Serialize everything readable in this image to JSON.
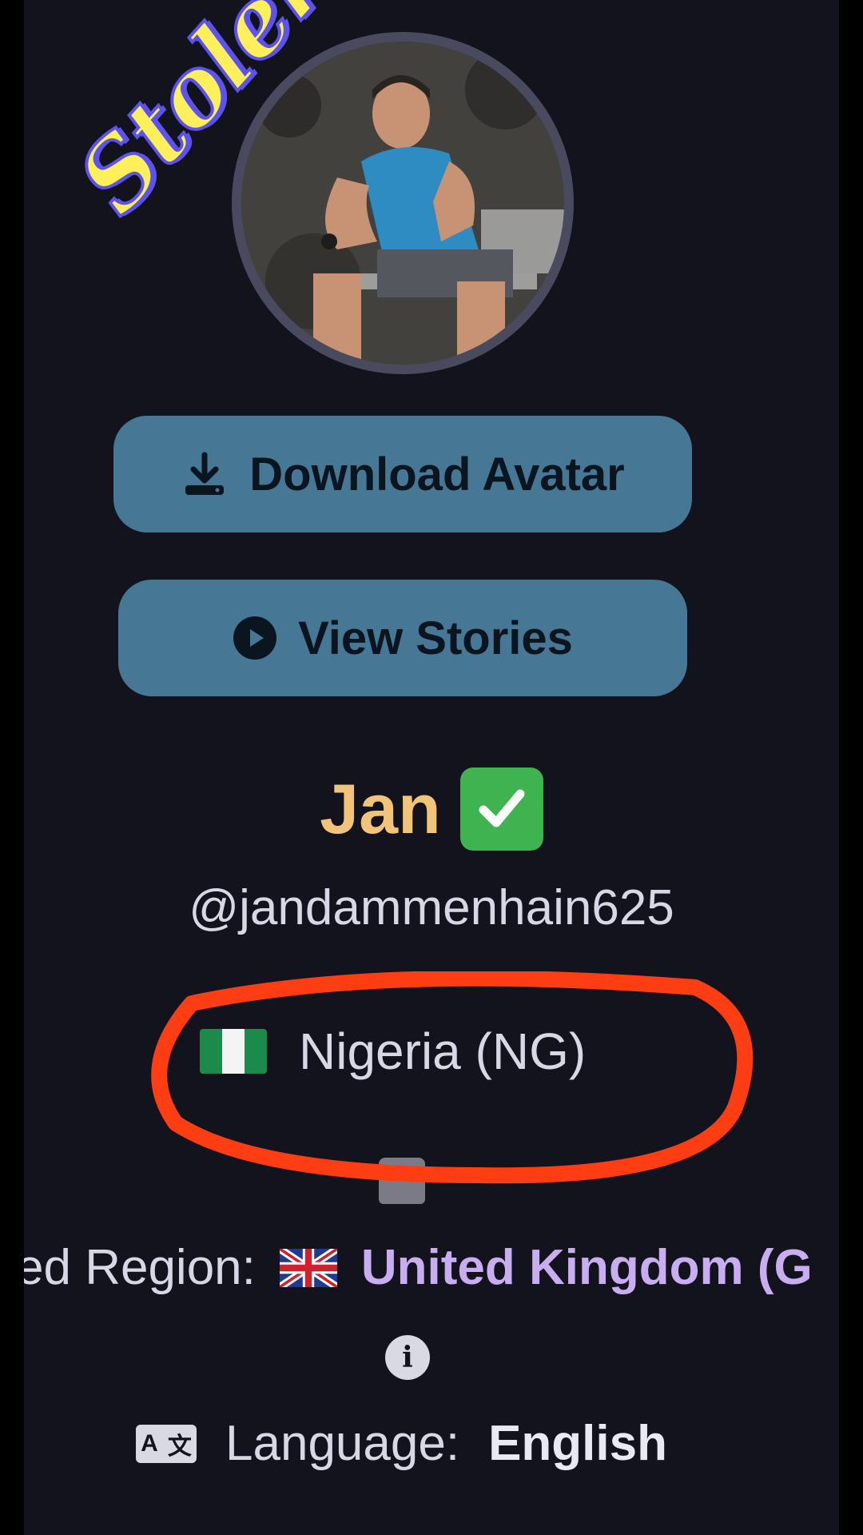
{
  "watermark": {
    "text": "Stolen"
  },
  "profile": {
    "avatar": "profile-photo",
    "name": "Jan",
    "verified_icon": "check-mark-icon",
    "username": "@jandammenhain625"
  },
  "buttons": {
    "download_avatar": "Download Avatar",
    "view_stories": "View Stories"
  },
  "country": {
    "flag": "nigeria-flag",
    "label": "Nigeria (NG)",
    "annotation_color": "#ff3d12"
  },
  "region": {
    "label": "ed Region:",
    "flag": "uk-flag",
    "value": "United Kingdom (G"
  },
  "language": {
    "label": "Language:",
    "value": "English"
  },
  "colors": {
    "background": "#13131d",
    "button": "#467794",
    "name": "#f1c47a",
    "region_value": "#c8aef0"
  }
}
